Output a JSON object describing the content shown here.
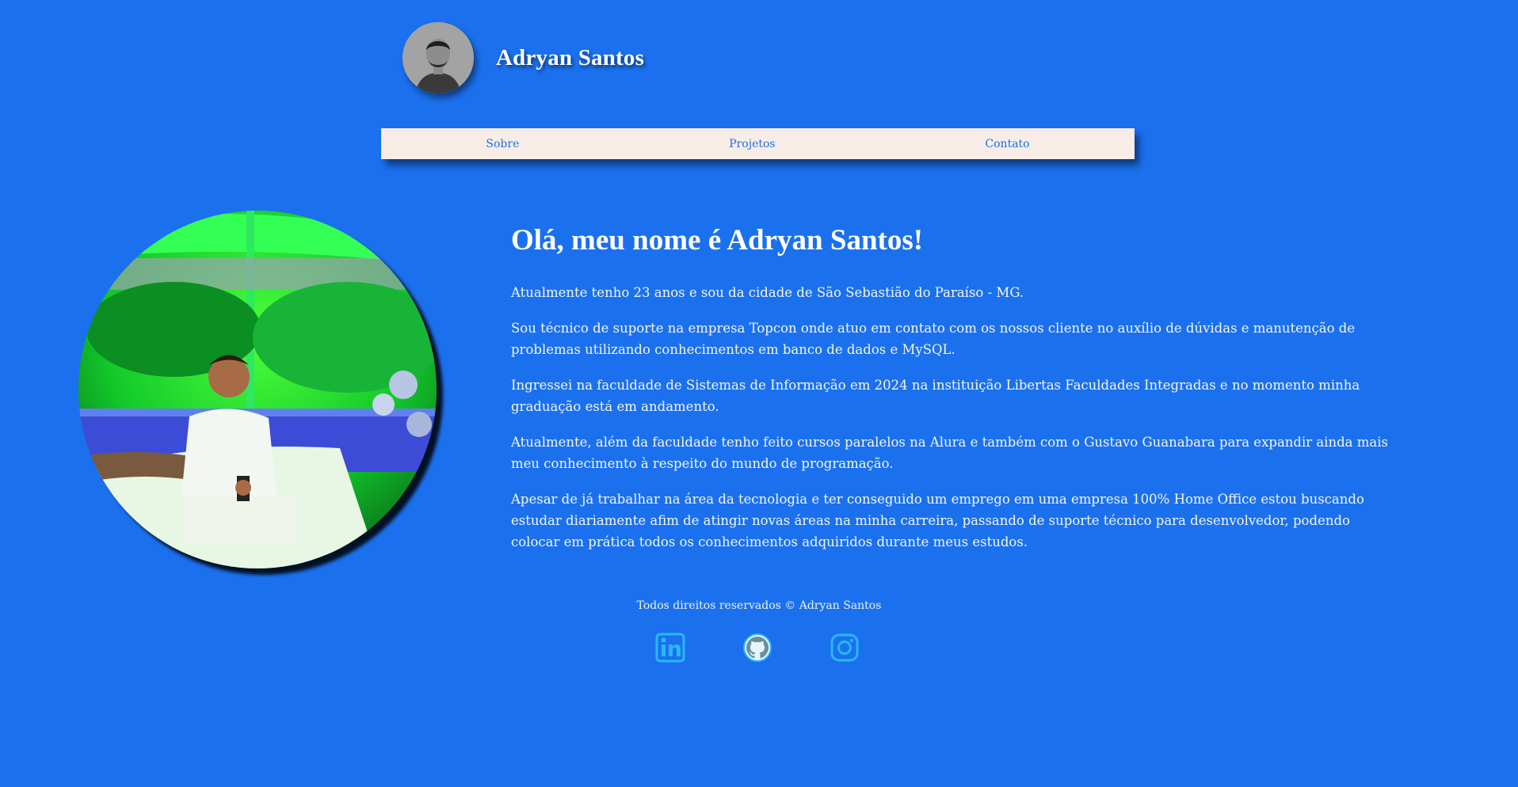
{
  "header": {
    "site_title": "Adryan Santos"
  },
  "nav": {
    "items": [
      {
        "label": "Sobre"
      },
      {
        "label": "Projetos"
      },
      {
        "label": "Contato"
      }
    ]
  },
  "main": {
    "heading": "Olá, meu nome é Adryan Santos!",
    "paragraphs": [
      "Atualmente tenho 23 anos e sou da cidade de São Sebastião do Paraíso - MG.",
      "Sou técnico de suporte na empresa Topcon onde atuo em contato com os nossos cliente no auxílio de dúvidas e manutenção de problemas utilizando conhecimentos em banco de dados e MySQL.",
      "Ingressei na faculdade de Sistemas de Informação em 2024 na instituição Libertas Faculdades Integradas e no momento minha graduação está em andamento.",
      "Atualmente, além da faculdade tenho feito cursos paralelos na Alura e também com o Gustavo Guanabara para expandir ainda mais meu conhecimento à respeito do mundo de programação.",
      "Apesar de já trabalhar na área da tecnologia e ter conseguido um emprego em uma empresa 100% Home Office estou buscando estudar diariamente afim de atingir novas áreas na minha carreira, passando de suporte técnico para desenvolvedor, podendo colocar em prática todos os conhecimentos adquiridos durante meus estudos."
    ]
  },
  "footer": {
    "copyright": "Todos direitos reservados © Adryan Santos",
    "social": [
      {
        "icon": "linkedin-icon"
      },
      {
        "icon": "github-icon"
      },
      {
        "icon": "instagram-icon"
      }
    ]
  },
  "colors": {
    "background": "#1b70ee",
    "nav_background": "#f7ede6",
    "nav_text": "#1b70ee",
    "social_icon": "#29b8f5"
  }
}
